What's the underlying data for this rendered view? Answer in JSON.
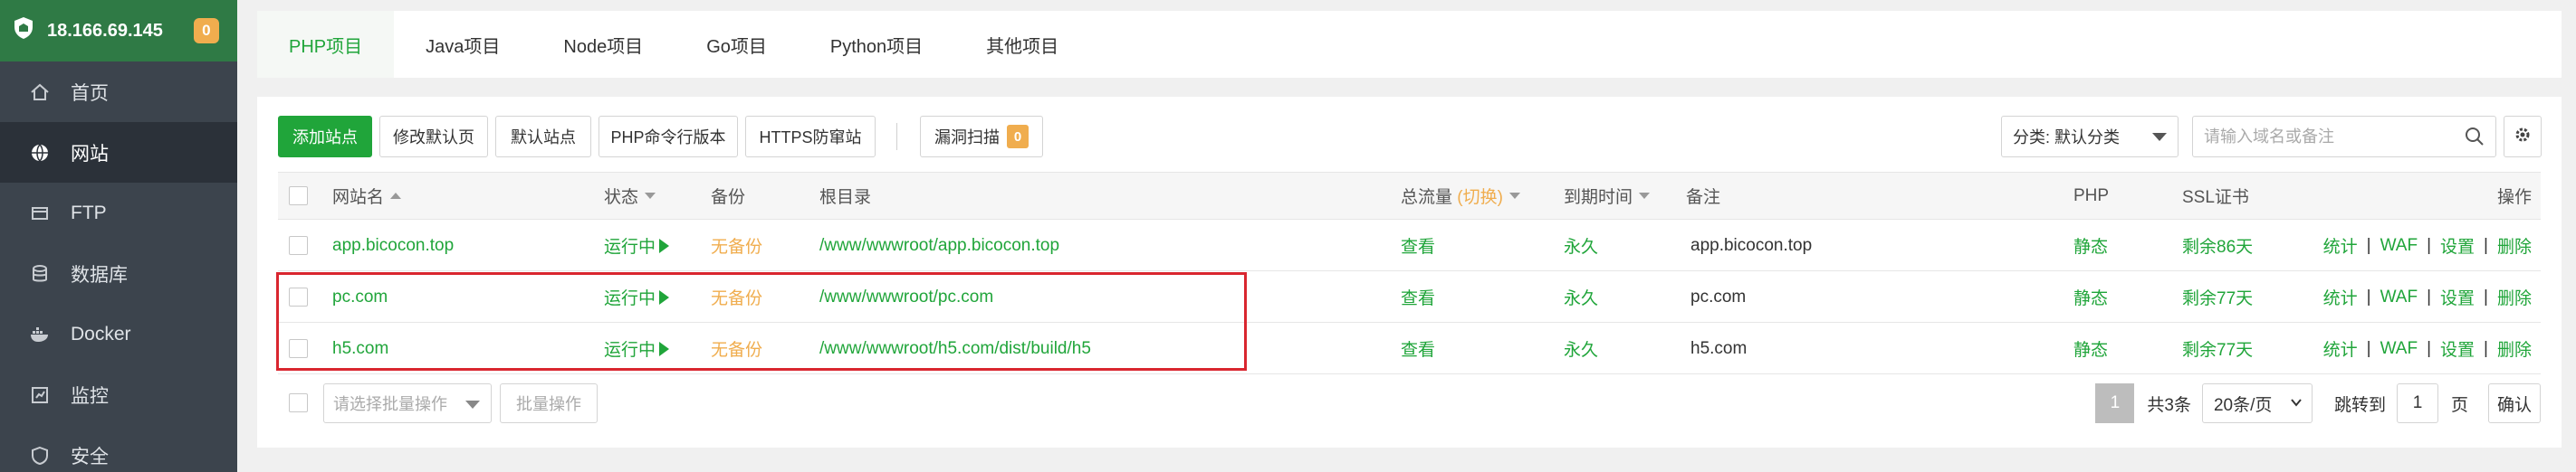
{
  "sidebar": {
    "server_ip": "18.166.69.145",
    "notification_count": "0",
    "items": [
      {
        "label": "首页",
        "icon": "home-icon"
      },
      {
        "label": "网站",
        "icon": "globe-icon"
      },
      {
        "label": "FTP",
        "icon": "ftp-icon"
      },
      {
        "label": "数据库",
        "icon": "database-icon"
      },
      {
        "label": "Docker",
        "icon": "docker-icon"
      },
      {
        "label": "监控",
        "icon": "monitor-icon"
      },
      {
        "label": "安全",
        "icon": "shield-icon"
      }
    ]
  },
  "tabs": [
    "PHP项目",
    "Java项目",
    "Node项目",
    "Go项目",
    "Python项目",
    "其他项目"
  ],
  "toolbar": {
    "add_site": "添加站点",
    "edit_default_page": "修改默认页",
    "default_site": "默认站点",
    "php_cli_version": "PHP命令行版本",
    "https_protection": "HTTPS防窜站",
    "vuln_scan": "漏洞扫描",
    "vuln_count": "0",
    "category_select": "分类: 默认分类",
    "search_placeholder": "请输入域名或备注"
  },
  "table": {
    "headers": {
      "name": "网站名",
      "status": "状态",
      "backup": "备份",
      "root": "根目录",
      "traffic": "总流量",
      "traffic_toggle": "(切换)",
      "expire": "到期时间",
      "note": "备注",
      "php": "PHP",
      "ssl": "SSL证书",
      "actions": "操作"
    },
    "rows": [
      {
        "name": "app.bicocon.top",
        "status": "运行中",
        "backup": "无备份",
        "root": "/www/wwwroot/app.bicocon.top",
        "traffic": "查看",
        "expire": "永久",
        "note": "app.bicocon.top",
        "php": "静态",
        "ssl": "剩余86天"
      },
      {
        "name": "pc.com",
        "status": "运行中",
        "backup": "无备份",
        "root": "/www/wwwroot/pc.com",
        "traffic": "查看",
        "expire": "永久",
        "note": "pc.com",
        "php": "静态",
        "ssl": "剩余77天"
      },
      {
        "name": "h5.com",
        "status": "运行中",
        "backup": "无备份",
        "root": "/www/wwwroot/h5.com/dist/build/h5",
        "traffic": "查看",
        "expire": "永久",
        "note": "h5.com",
        "php": "静态",
        "ssl": "剩余77天"
      }
    ],
    "row_actions": [
      "统计",
      "WAF",
      "设置",
      "删除"
    ]
  },
  "footer": {
    "batch_select_placeholder": "请选择批量操作",
    "batch_button": "批量操作",
    "current_page": "1",
    "total": "共3条",
    "page_size": "20条/页",
    "jump_to": "跳转到",
    "jump_value": "1",
    "page_unit": "页",
    "confirm": "确认"
  },
  "colors": {
    "accent": "#20a53a",
    "warning": "#f0ad4e",
    "highlight_border": "#d9262f",
    "sidebar_bg": "#3c444d",
    "sidebar_header_bg": "#2f7a45"
  }
}
